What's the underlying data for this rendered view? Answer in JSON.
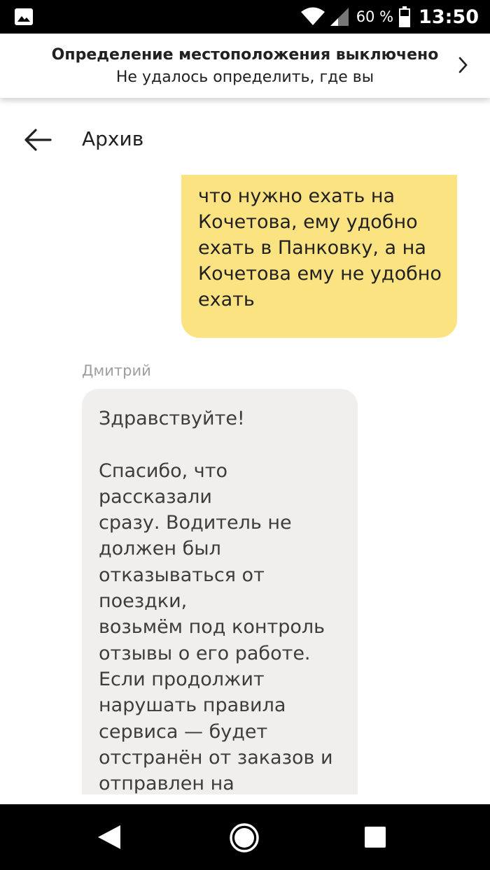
{
  "status_bar": {
    "battery_text": "60 %",
    "time": "13:50",
    "icons": [
      "gallery-icon",
      "wifi-icon",
      "signal-icon",
      "battery-icon"
    ]
  },
  "banner": {
    "title": "Определение местоположения выключено",
    "subtitle": "Не удалось определить, где вы"
  },
  "header": {
    "title": "Архив"
  },
  "messages": [
    {
      "direction": "outgoing",
      "text": "что нужно ехать на\nКочетова, ему удобно\nехать в Панковку, а на\nКочетова ему не удобно\nехать"
    },
    {
      "direction": "incoming",
      "sender": "Дмитрий",
      "text": "Здравствуйте!\n\nСпасибо, что рассказали\nсразу. Водитель не\nдолжен был\nотказываться от поездки,\nвозьмём под контроль\nотзывы о его работе.\nЕсли продолжит\nнарушать правила\nсервиса — будет\nотстранён от заказов и\nотправлен на повторную\nпроверку."
    }
  ],
  "colors": {
    "outgoing_bubble": "#fce382",
    "incoming_bubble": "#f0efed",
    "sender_name": "#9e9e9e",
    "system_bar": "#000000"
  }
}
